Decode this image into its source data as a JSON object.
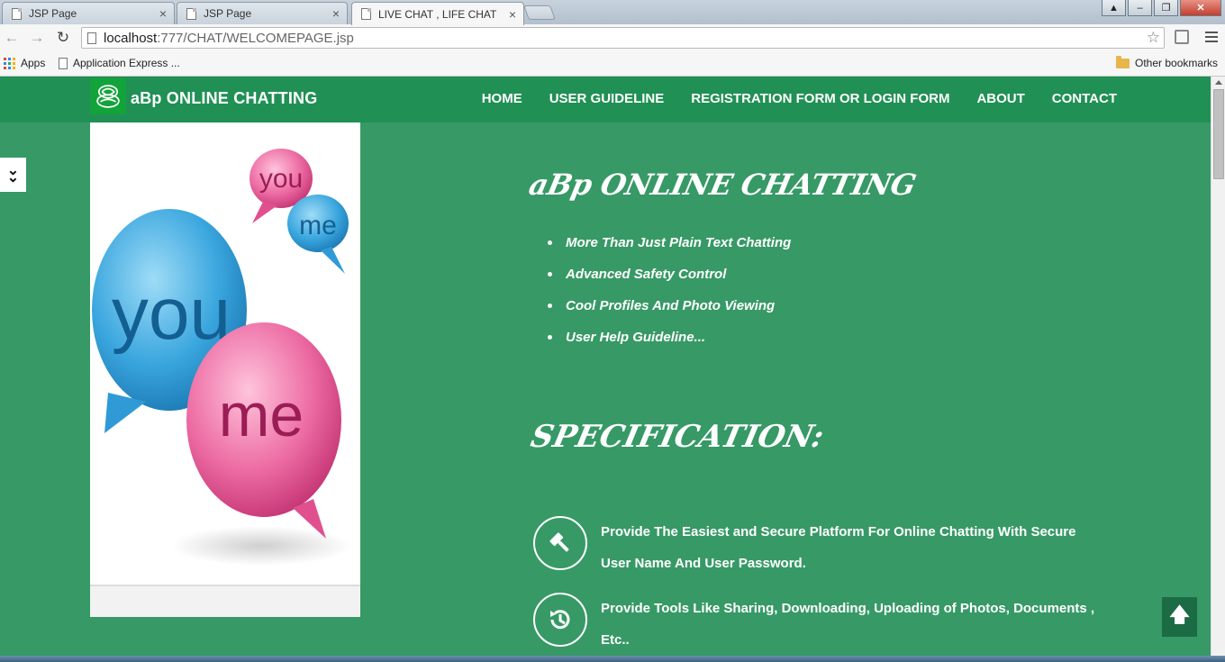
{
  "browser": {
    "tabs": [
      {
        "label": "JSP Page",
        "active": false
      },
      {
        "label": "JSP Page",
        "active": false
      },
      {
        "label": "LIVE CHAT , LIFE CHAT",
        "active": true
      }
    ],
    "url_host": "localhost",
    "url_rest": ":777/CHAT/WELCOMEPAGE.jsp",
    "bookmarks": {
      "apps": "Apps",
      "app_express": "Application Express ...",
      "other": "Other bookmarks"
    }
  },
  "site": {
    "brand": "aBp ONLINE CHATTING",
    "nav": [
      "HOME",
      "USER GUIDELINE",
      "REGISTRATION FORM OR LOGIN FORM",
      "ABOUT",
      "CONTACT"
    ],
    "hero": {
      "title": "aBp ONLINE CHATTING",
      "features": [
        "More Than Just Plain Text Chatting",
        "Advanced Safety Control",
        "Cool Profiles And Photo Viewing",
        "User Help Guideline..."
      ]
    },
    "spec_title": "SPECIFICATION:",
    "specs": [
      {
        "icon": "gavel-icon",
        "text": "Provide The Easiest and Secure Platform For Online Chatting With Secure User Name And User Password."
      },
      {
        "icon": "history-icon",
        "text": "Provide Tools Like Sharing, Downloading, Uploading of Photos, Documents , Etc.."
      }
    ],
    "image_words": {
      "big_blue": "you",
      "big_pink": "me",
      "small_pink": "you",
      "small_blue": "me"
    }
  },
  "colors": {
    "page_bg": "#379966",
    "nav_bg": "#209055",
    "text": "#ffffff",
    "bubble_blue": "#2f9ad6",
    "bubble_pink": "#e0508f"
  }
}
